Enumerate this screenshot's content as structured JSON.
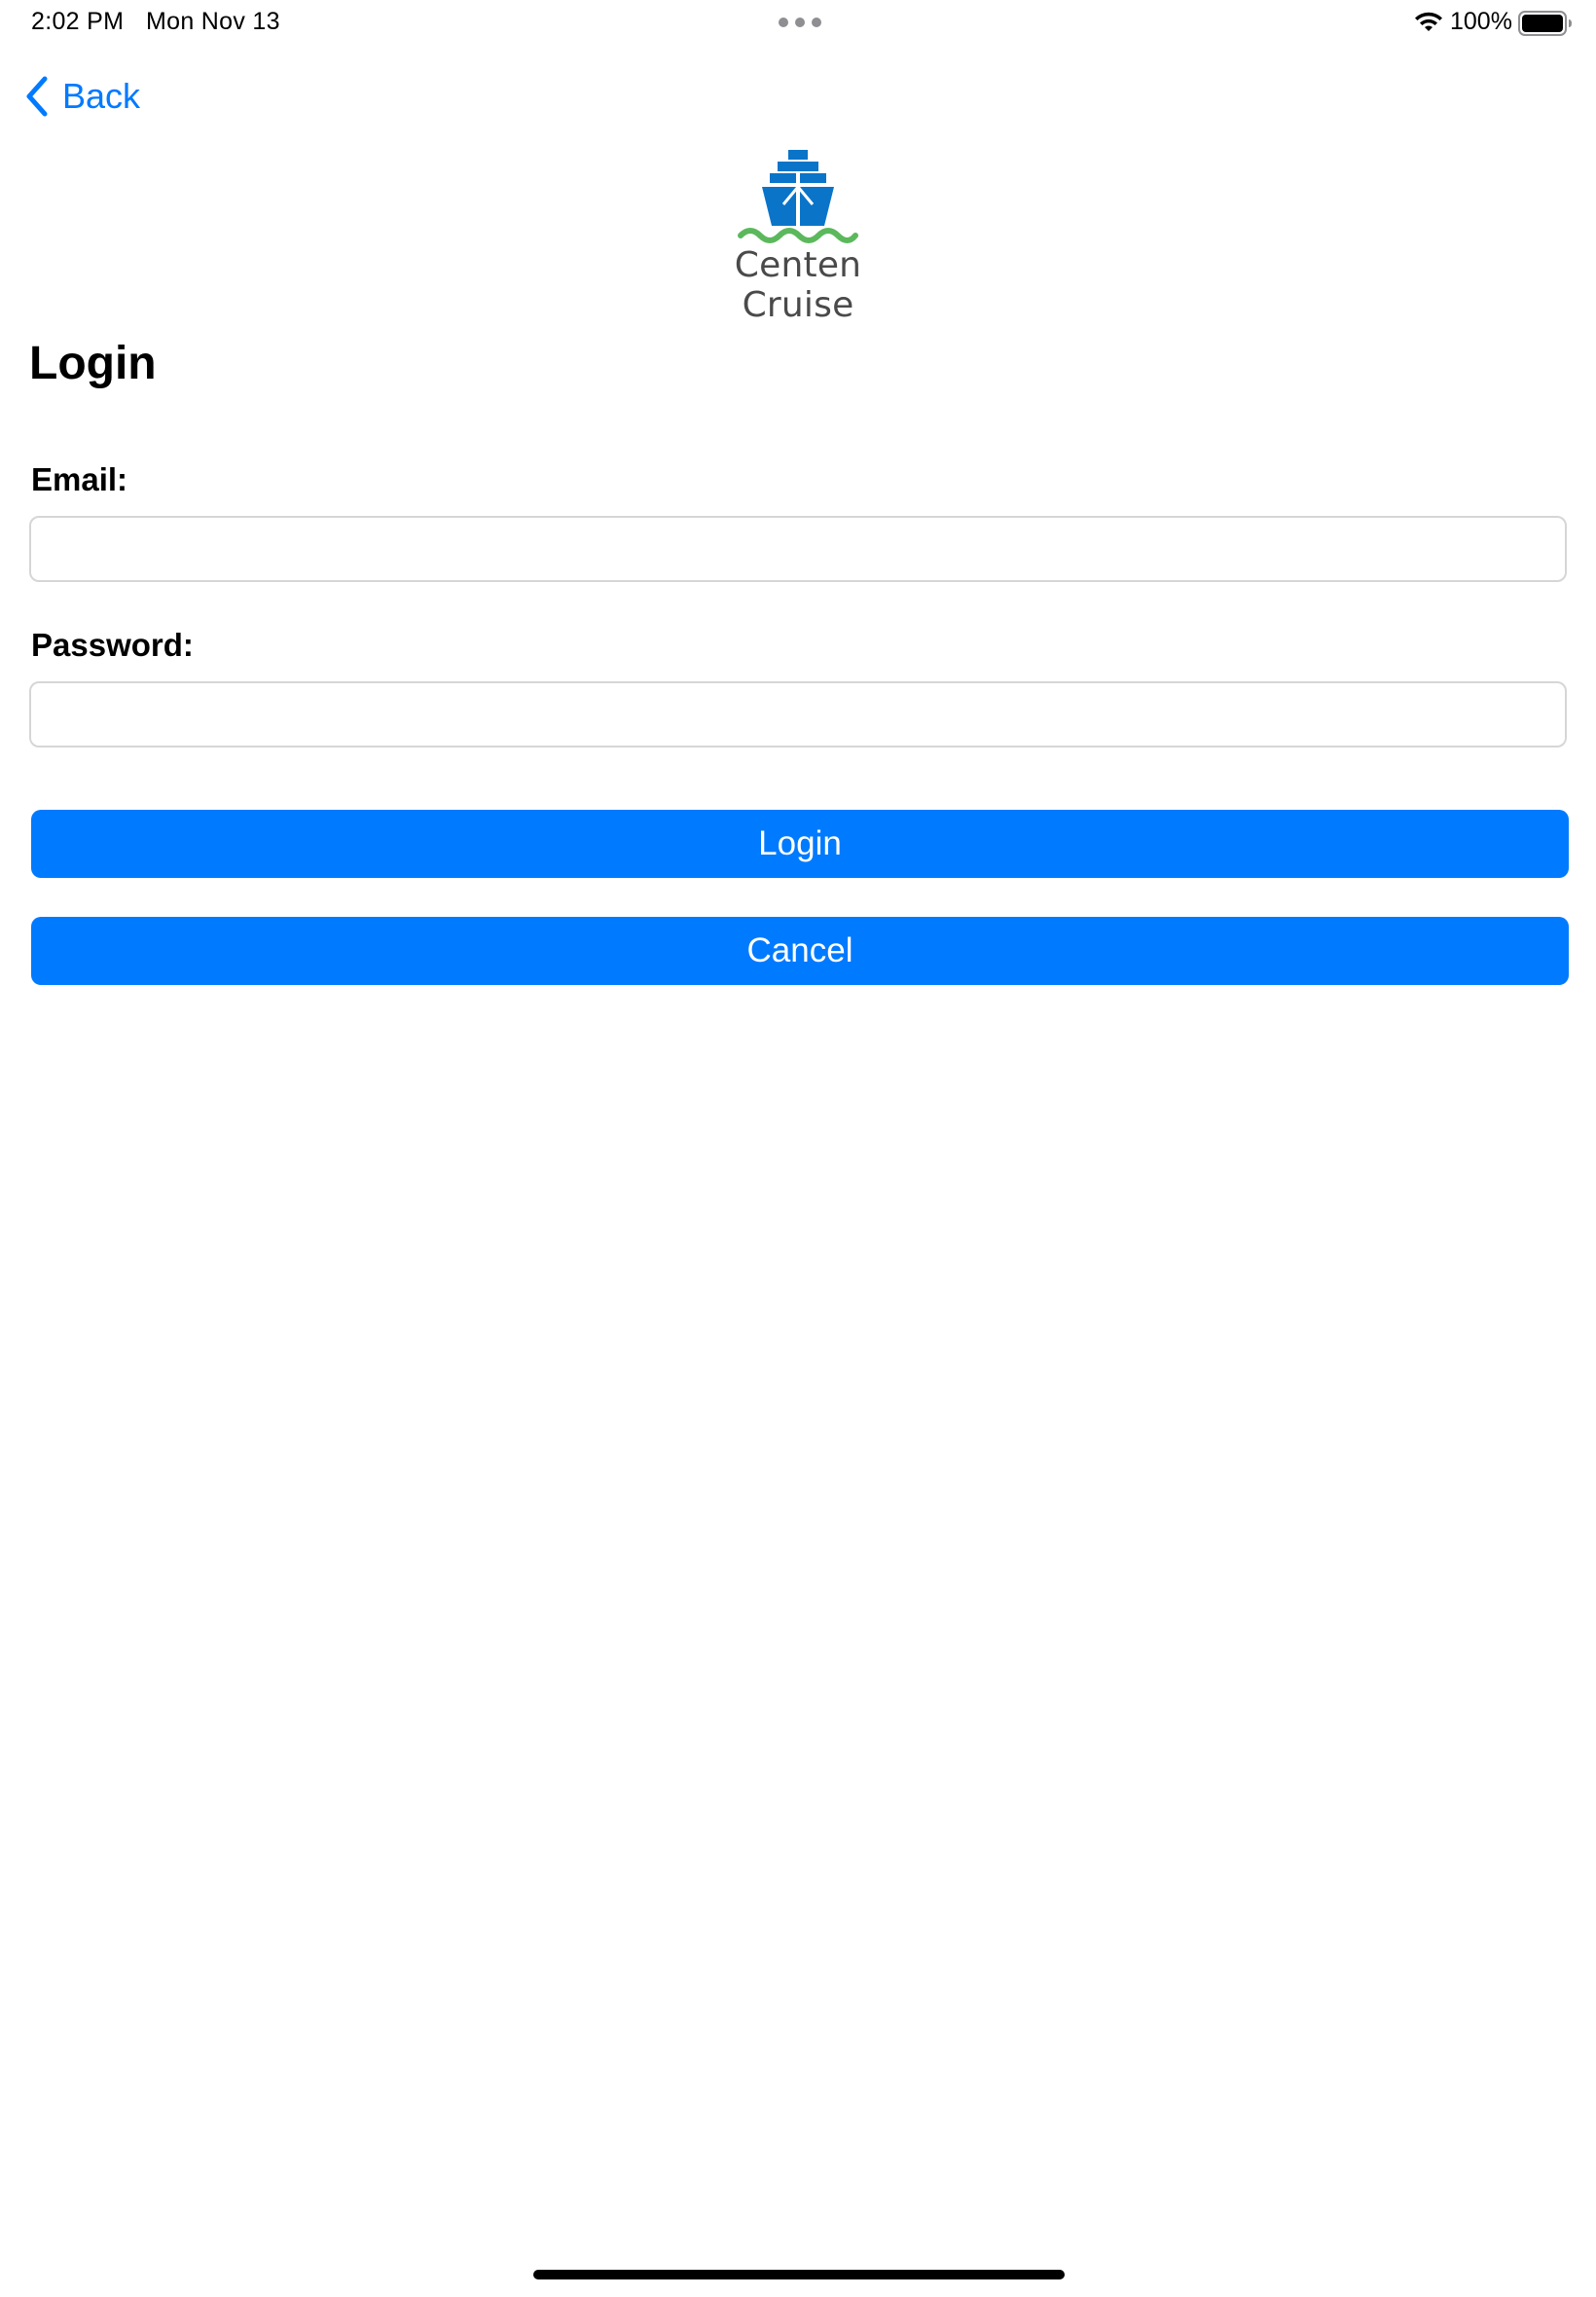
{
  "status_bar": {
    "time": "2:02 PM",
    "date": "Mon Nov 13",
    "battery": "100%",
    "icons": [
      "wifi-icon",
      "battery-icon",
      "multitask-dots-icon"
    ]
  },
  "nav": {
    "back_label": "Back",
    "icon": "chevron-left-icon"
  },
  "logo": {
    "text": "Centen Cruise",
    "icon": "ship-icon"
  },
  "page": {
    "title": "Login"
  },
  "form": {
    "email_label": "Email:",
    "email_value": "",
    "email_placeholder": "",
    "password_label": "Password:",
    "password_value": "",
    "password_placeholder": ""
  },
  "buttons": {
    "login": "Login",
    "cancel": "Cancel"
  },
  "colors": {
    "accent": "#007aff",
    "logo_ship": "#0a74c9",
    "logo_waves": "#5cb85c",
    "logo_text": "#4a4a4a"
  }
}
